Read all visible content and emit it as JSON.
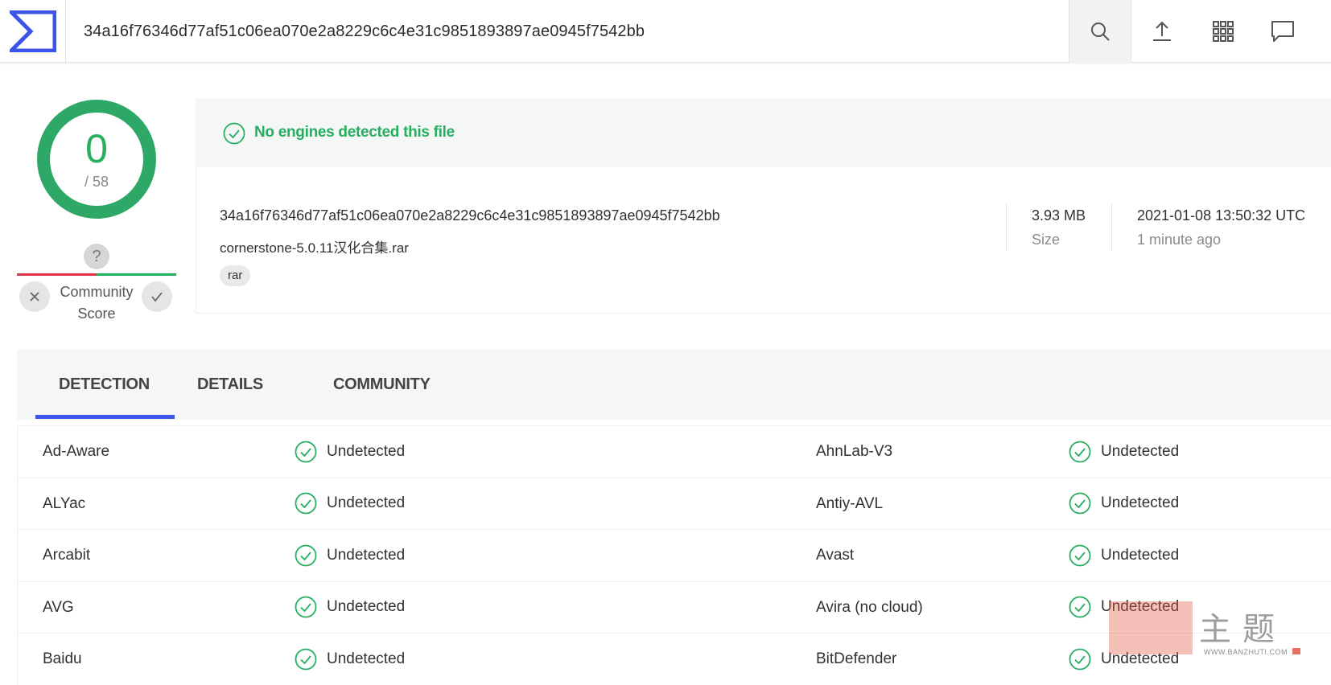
{
  "topbar": {
    "query": "34a16f76346d77af51c06ea070e2a8229c6c4e31c9851893897ae0945f7542bb",
    "icons": [
      "search-icon",
      "upload-icon",
      "apps-grid-icon",
      "chat-icon"
    ]
  },
  "score": {
    "detections": "0",
    "total": "/ 58",
    "community_label_line1": "Community",
    "community_label_line2": "Score",
    "question_mark": "?"
  },
  "banner": {
    "message": "No engines detected this file"
  },
  "file": {
    "hash": "34a16f76346d77af51c06ea070e2a8229c6c4e31c9851893897ae0945f7542bb",
    "name": "cornerstone-5.0.11汉化合集.rar",
    "tag": "rar",
    "size_value": "3.93 MB",
    "size_label": "Size",
    "date_value": "2021-01-08 13:50:32 UTC",
    "date_label": "1 minute ago"
  },
  "tabs": {
    "detection": "DETECTION",
    "details": "DETAILS",
    "community": "COMMUNITY",
    "active": "DETECTION"
  },
  "detections": [
    {
      "left_engine": "Ad-Aware",
      "left_result": "Undetected",
      "right_engine": "AhnLab-V3",
      "right_result": "Undetected"
    },
    {
      "left_engine": "ALYac",
      "left_result": "Undetected",
      "right_engine": "Antiy-AVL",
      "right_result": "Undetected"
    },
    {
      "left_engine": "Arcabit",
      "left_result": "Undetected",
      "right_engine": "Avast",
      "right_result": "Undetected"
    },
    {
      "left_engine": "AVG",
      "left_result": "Undetected",
      "right_engine": "Avira (no cloud)",
      "right_result": "Undetected"
    },
    {
      "left_engine": "Baidu",
      "left_result": "Undetected",
      "right_engine": "BitDefender",
      "right_result": "Undetected"
    }
  ],
  "watermark": {
    "text": "主题",
    "url": "WWW.BANZHUTI.COM"
  },
  "colors": {
    "clean_green": "#27ae60",
    "accent_blue": "#3a55e8",
    "malicious_red": "#e0334a"
  }
}
